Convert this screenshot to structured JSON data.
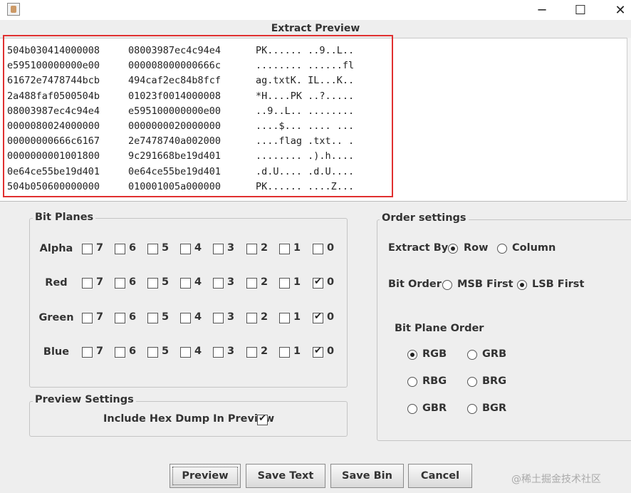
{
  "window": {
    "minimize": "─",
    "maximize": "☐",
    "close": "✕"
  },
  "preview": {
    "title": "Extract Preview",
    "lines": [
      [
        "504b030414000008",
        "08003987ec4c94e4",
        "PK...... ..9..L.."
      ],
      [
        "e595100000000e00",
        "000008000000666c",
        "........ ......fl"
      ],
      [
        "61672e7478744bcb",
        "494caf2ec84b8fcf",
        "ag.txtK. IL...K.."
      ],
      [
        "2a488faf0500504b",
        "01023f0014000008",
        "*H....PK ..?....."
      ],
      [
        "08003987ec4c94e4",
        "e595100000000e00",
        "..9..L.. ........"
      ],
      [
        "0000080024000000",
        "0000000020000000",
        "....$... .... ..."
      ],
      [
        "00000000666c6167",
        "2e7478740a002000",
        "....flag .txt.. ."
      ],
      [
        "0000000001001800",
        "9c291668be19d401",
        "........ .).h...."
      ],
      [
        "0e64ce55be19d401",
        "0e64ce55be19d401",
        ".d.U.... .d.U...."
      ],
      [
        "504b050600000000",
        "010001005a000000",
        "PK...... ....Z..."
      ]
    ]
  },
  "bit_planes": {
    "title": "Bit Planes",
    "bits": [
      "7",
      "6",
      "5",
      "4",
      "3",
      "2",
      "1",
      "0"
    ],
    "rows": [
      {
        "label": "Alpha",
        "checked": [
          false,
          false,
          false,
          false,
          false,
          false,
          false,
          false
        ]
      },
      {
        "label": "Red",
        "checked": [
          false,
          false,
          false,
          false,
          false,
          false,
          false,
          true
        ]
      },
      {
        "label": "Green",
        "checked": [
          false,
          false,
          false,
          false,
          false,
          false,
          false,
          true
        ]
      },
      {
        "label": "Blue",
        "checked": [
          false,
          false,
          false,
          false,
          false,
          false,
          false,
          true
        ]
      }
    ]
  },
  "preview_settings": {
    "title": "Preview Settings",
    "include_hex_label": "Include Hex Dump In Preview",
    "include_hex_checked": true
  },
  "order_settings": {
    "title": "Order settings",
    "extract_by_label": "Extract By",
    "extract_by_options": [
      "Row",
      "Column"
    ],
    "extract_by_selected": "Row",
    "bit_order_label": "Bit Order",
    "bit_order_options": [
      "MSB First",
      "LSB First"
    ],
    "bit_order_selected": "LSB First",
    "plane_order_label": "Bit Plane Order",
    "plane_order_options": [
      "RGB",
      "GRB",
      "RBG",
      "BRG",
      "GBR",
      "BGR"
    ],
    "plane_order_selected": "RGB"
  },
  "buttons": {
    "preview": "Preview",
    "save_text": "Save Text",
    "save_bin": "Save Bin",
    "cancel": "Cancel"
  },
  "watermark": "@稀土掘金技术社区"
}
